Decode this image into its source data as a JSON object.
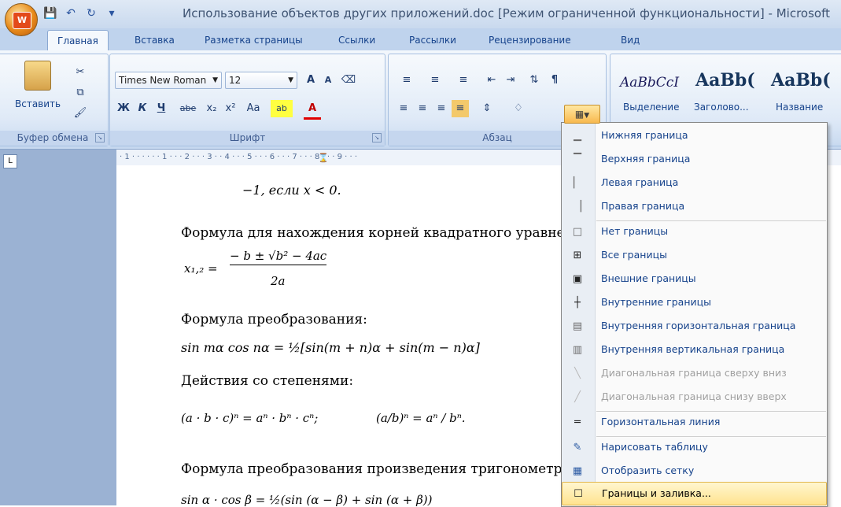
{
  "window": {
    "title": "Использование объектов других приложений.doc [Режим ограниченной функциональности] - Microsoft"
  },
  "quick_access": [
    "save-icon",
    "undo-icon",
    "redo-icon",
    "customize-icon"
  ],
  "tabs": [
    {
      "label": "Главная",
      "active": true
    },
    {
      "label": "Вставка"
    },
    {
      "label": "Разметка страницы"
    },
    {
      "label": "Ссылки"
    },
    {
      "label": "Рассылки"
    },
    {
      "label": "Рецензирование"
    },
    {
      "label": "Вид"
    }
  ],
  "clipboard": {
    "paste_label": "Вставить",
    "group_label": "Буфер обмена"
  },
  "font": {
    "name": "Times New Roman",
    "size": "12",
    "group_label": "Шрифт",
    "bold": "Ж",
    "italic": "К",
    "underline": "Ч",
    "strike": "abe",
    "subscript": "x₂",
    "superscript": "x²",
    "case": "Aa",
    "grow": "A",
    "shrink": "A",
    "highlight": "ab",
    "color": "A"
  },
  "paragraph": {
    "group_label": "Абзац"
  },
  "styles": [
    {
      "sample": "AaBbCcI",
      "label": "Выделение"
    },
    {
      "sample": "AaBb(",
      "label": "Заголово..."
    },
    {
      "sample": "AaBb(",
      "label": "Название"
    }
  ],
  "ruler": {
    "text": "· 1 · · ·   · · · 1 · · · 2 · · · 3 ·   · 4 · · · 5 · · · 6 · · · 7 · · · 8 · · · 9 · · ·"
  },
  "document": {
    "lines": [
      "−1, если  x < 0.",
      "Формула для нахождения корней квадратного уравне",
      "Формула преобразования:",
      "Действия со степенями:",
      "Формула преобразования произведения тригонометр"
    ],
    "formulas": {
      "quadratic_lhs": "x₁,₂ =",
      "quadratic_num": "− b ± √b² − 4ac",
      "quadratic_den": "2a",
      "transform": "sin  mα cos nα = ½[sin(m + n)α + sin(m − n)α]",
      "power1": "(a · b · c)ⁿ = aⁿ · bⁿ · cⁿ;",
      "power2": "(a/b)ⁿ = aⁿ / bⁿ.",
      "trig": "sin α · cos β = ½(sin (α − β) + sin (α + β))"
    }
  },
  "borders_menu": {
    "items": [
      {
        "label": "Нижняя граница",
        "icon": "bottom-border-icon",
        "disabled": false
      },
      {
        "label": "Верхняя граница",
        "icon": "top-border-icon",
        "disabled": false
      },
      {
        "label": "Левая граница",
        "icon": "left-border-icon",
        "disabled": false
      },
      {
        "label": "Правая граница",
        "icon": "right-border-icon",
        "disabled": false
      },
      {
        "label": "Нет границы",
        "icon": "no-border-icon",
        "disabled": false
      },
      {
        "label": "Все границы",
        "icon": "all-borders-icon",
        "disabled": false
      },
      {
        "label": "Внешние границы",
        "icon": "outside-borders-icon",
        "disabled": false
      },
      {
        "label": "Внутренние границы",
        "icon": "inside-borders-icon",
        "disabled": false
      },
      {
        "label": "Внутренняя горизонтальная граница",
        "icon": "inside-horizontal-border-icon",
        "disabled": false
      },
      {
        "label": "Внутренняя вертикальная граница",
        "icon": "inside-vertical-border-icon",
        "disabled": false
      },
      {
        "label": "Диагональная граница сверху вниз",
        "icon": "diagonal-down-border-icon",
        "disabled": true
      },
      {
        "label": "Диагональная граница снизу вверх",
        "icon": "diagonal-up-border-icon",
        "disabled": true
      },
      {
        "label": "Горизонтальная линия",
        "icon": "horizontal-line-icon",
        "disabled": false
      },
      {
        "label": "Нарисовать таблицу",
        "icon": "draw-table-icon",
        "disabled": false
      },
      {
        "label": "Отобразить сетку",
        "icon": "view-gridlines-icon",
        "disabled": false
      },
      {
        "label": "Границы и заливка...",
        "icon": "borders-shading-icon",
        "disabled": false,
        "highlighted": true
      }
    ]
  }
}
